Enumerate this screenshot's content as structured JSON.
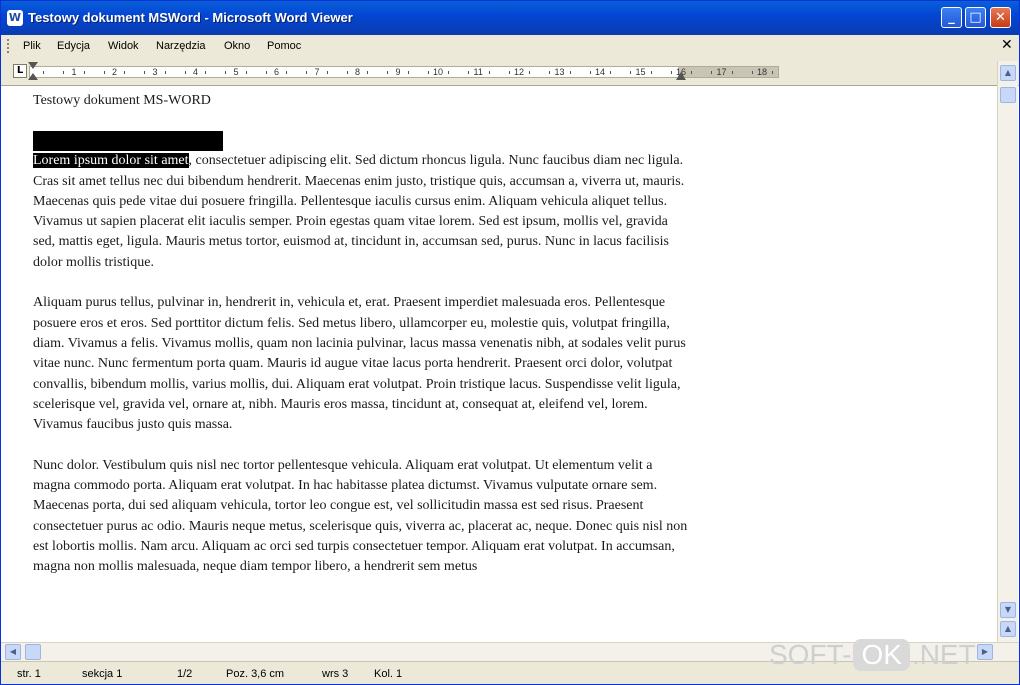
{
  "window": {
    "title": "Testowy dokument MSWord - Microsoft Word Viewer",
    "app_icon": "W"
  },
  "window_buttons": {
    "minimize": "_",
    "maximize": "□",
    "close": "✕"
  },
  "menu": {
    "items": [
      "Plik",
      "Edycja",
      "Widok",
      "Narzędzia",
      "Okno",
      "Pomoc"
    ],
    "close_doc": "✕"
  },
  "ruler": {
    "tab_selector": "L",
    "numbers": [
      "1",
      "2",
      "3",
      "4",
      "5",
      "6",
      "7",
      "8",
      "9",
      "10",
      "11",
      "12",
      "13",
      "14",
      "15",
      "16",
      "17",
      "18"
    ]
  },
  "document": {
    "title": "Testowy dokument MS-WORD",
    "paragraphs": [
      {
        "selected": "Lorem ipsum dolor sit amet",
        "text": ", consectetuer adipiscing elit. Sed dictum rhoncus ligula. Nunc faucibus diam nec ligula. Cras sit amet tellus nec dui bibendum hendrerit. Maecenas enim justo, tristique quis, accumsan a, viverra ut, mauris. Maecenas quis pede vitae dui posuere fringilla. Pellentesque iaculis cursus enim. Aliquam vehicula aliquet tellus. Vivamus ut sapien placerat elit iaculis semper. Proin egestas quam vitae lorem. Sed est ipsum, mollis vel, gravida sed, mattis eget, ligula. Mauris metus tortor, euismod at, tincidunt in, accumsan sed, purus. Nunc in lacus facilisis dolor mollis tristique."
      },
      {
        "text": "Aliquam purus tellus, pulvinar in, hendrerit in, vehicula et, erat. Praesent imperdiet malesuada eros. Pellentesque posuere eros et eros. Sed porttitor dictum felis. Sed metus libero, ullamcorper eu, molestie quis, volutpat fringilla, diam. Vivamus a felis. Vivamus mollis, quam non lacinia pulvinar, lacus massa venenatis nibh, at sodales velit purus vitae nunc. Nunc fermentum porta quam. Mauris id augue vitae lacus porta hendrerit. Praesent orci dolor, volutpat convallis, bibendum mollis, varius mollis, dui. Aliquam erat volutpat. Proin tristique lacus. Suspendisse velit ligula, scelerisque vel, gravida vel, ornare at, nibh. Mauris eros massa, tincidunt at, consequat at, eleifend vel, lorem. Vivamus faucibus justo quis massa."
      },
      {
        "text": "Nunc dolor. Vestibulum quis nisl nec tortor pellentesque vehicula. Aliquam erat volutpat. Ut elementum velit a magna commodo porta. Aliquam erat volutpat. In hac habitasse platea dictumst. Vivamus vulputate ornare sem. Maecenas porta, dui sed aliquam vehicula, tortor leo congue est, vel sollicitudin massa est sed risus. Praesent consectetuer purus ac odio. Mauris neque metus, scelerisque quis, viverra ac, placerat ac, neque. Donec quis nisl non est lobortis mollis. Nam arcu. Aliquam ac orci sed turpis consectetuer tempor. Aliquam erat volutpat. In accumsan, magna non mollis malesuada, neque diam tempor libero, a hendrerit sem metus"
      }
    ]
  },
  "status": {
    "page": "str. 1",
    "section": "sekcja 1",
    "pages": "1/2",
    "position": "Poz. 3,6 cm",
    "line": "wrs 3",
    "column": "Kol. 1"
  },
  "watermark": {
    "left": "SOFT-",
    "mid": "OK",
    "right": ".NET"
  }
}
